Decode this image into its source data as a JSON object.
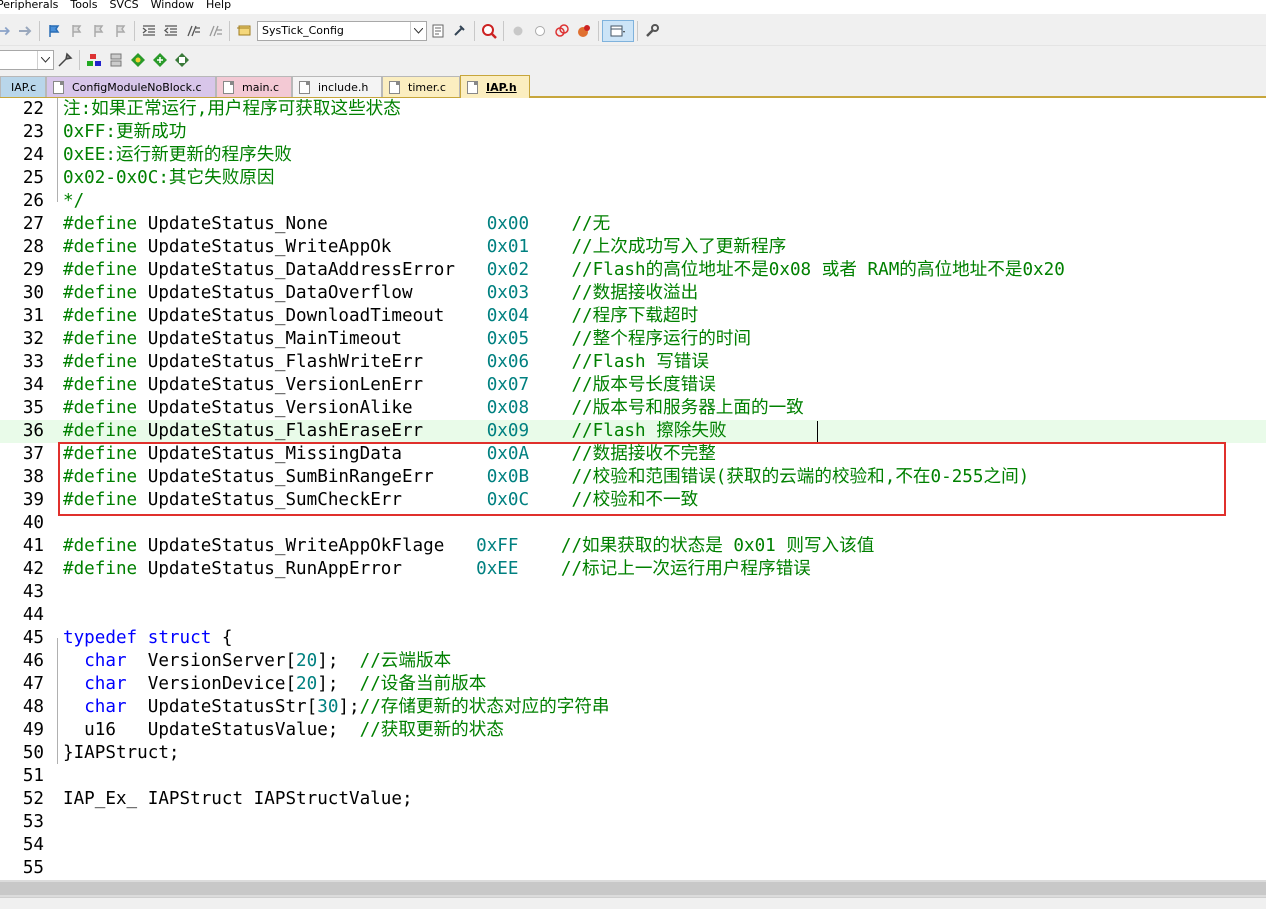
{
  "menu": [
    "Peripherals",
    "Tools",
    "SVCS",
    "Window",
    "Help"
  ],
  "toolbar": {
    "target_combo": "SysTick_Config"
  },
  "tabs": [
    {
      "label": "IAP.c",
      "color": "#b9d6ea"
    },
    {
      "label": "ConfigModuleNoBlock.c",
      "color": "#d8c6ea"
    },
    {
      "label": "main.c",
      "color": "#f3c9d4"
    },
    {
      "label": "include.h",
      "color": "#f4f4f4"
    },
    {
      "label": "timer.c",
      "color": "#fbeec0"
    },
    {
      "label": "IAP.h",
      "color": "#fbeec0"
    }
  ],
  "code": [
    {
      "n": "22",
      "t": [
        [
          "cm",
          "注:如果正常运行,用户程序可获取这些状态"
        ]
      ]
    },
    {
      "n": "23",
      "t": [
        [
          "cm",
          "0xFF:更新成功"
        ]
      ]
    },
    {
      "n": "24",
      "t": [
        [
          "cm",
          "0xEE:运行新更新的程序失败"
        ]
      ]
    },
    {
      "n": "25",
      "t": [
        [
          "cm",
          "0x02-0x0C:其它失败原因"
        ]
      ]
    },
    {
      "n": "26",
      "t": [
        [
          "cm",
          "*/"
        ]
      ]
    },
    {
      "n": "27",
      "t": [
        [
          "cm",
          "#define"
        ],
        [
          "tx",
          " UpdateStatus_None               "
        ],
        [
          "nm",
          "0x00"
        ],
        [
          "tx",
          "    "
        ],
        [
          "cm",
          "//无"
        ]
      ]
    },
    {
      "n": "28",
      "t": [
        [
          "cm",
          "#define"
        ],
        [
          "tx",
          " UpdateStatus_WriteAppOk         "
        ],
        [
          "nm",
          "0x01"
        ],
        [
          "tx",
          "    "
        ],
        [
          "cm",
          "//上次成功写入了更新程序"
        ]
      ]
    },
    {
      "n": "29",
      "t": [
        [
          "cm",
          "#define"
        ],
        [
          "tx",
          " UpdateStatus_DataAddressError   "
        ],
        [
          "nm",
          "0x02"
        ],
        [
          "tx",
          "    "
        ],
        [
          "cm",
          "//Flash的高位地址不是0x08 或者 RAM的高位地址不是0x20"
        ]
      ]
    },
    {
      "n": "30",
      "t": [
        [
          "cm",
          "#define"
        ],
        [
          "tx",
          " UpdateStatus_DataOverflow       "
        ],
        [
          "nm",
          "0x03"
        ],
        [
          "tx",
          "    "
        ],
        [
          "cm",
          "//数据接收溢出"
        ]
      ]
    },
    {
      "n": "31",
      "t": [
        [
          "cm",
          "#define"
        ],
        [
          "tx",
          " UpdateStatus_DownloadTimeout    "
        ],
        [
          "nm",
          "0x04"
        ],
        [
          "tx",
          "    "
        ],
        [
          "cm",
          "//程序下载超时"
        ]
      ]
    },
    {
      "n": "32",
      "t": [
        [
          "cm",
          "#define"
        ],
        [
          "tx",
          " UpdateStatus_MainTimeout        "
        ],
        [
          "nm",
          "0x05"
        ],
        [
          "tx",
          "    "
        ],
        [
          "cm",
          "//整个程序运行的时间"
        ]
      ]
    },
    {
      "n": "33",
      "t": [
        [
          "cm",
          "#define"
        ],
        [
          "tx",
          " UpdateStatus_FlashWriteErr      "
        ],
        [
          "nm",
          "0x06"
        ],
        [
          "tx",
          "    "
        ],
        [
          "cm",
          "//Flash 写错误"
        ]
      ]
    },
    {
      "n": "34",
      "t": [
        [
          "cm",
          "#define"
        ],
        [
          "tx",
          " UpdateStatus_VersionLenErr      "
        ],
        [
          "nm",
          "0x07"
        ],
        [
          "tx",
          "    "
        ],
        [
          "cm",
          "//版本号长度错误"
        ]
      ]
    },
    {
      "n": "35",
      "t": [
        [
          "cm",
          "#define"
        ],
        [
          "tx",
          " UpdateStatus_VersionAlike       "
        ],
        [
          "nm",
          "0x08"
        ],
        [
          "tx",
          "    "
        ],
        [
          "cm",
          "//版本号和服务器上面的一致"
        ]
      ]
    },
    {
      "n": "36",
      "t": [
        [
          "cm",
          "#define"
        ],
        [
          "tx",
          " UpdateStatus_FlashEraseErr      "
        ],
        [
          "nm",
          "0x09"
        ],
        [
          "tx",
          "    "
        ],
        [
          "cm",
          "//Flash 擦除失败"
        ]
      ]
    },
    {
      "n": "37",
      "t": [
        [
          "cm",
          "#define"
        ],
        [
          "tx",
          " UpdateStatus_MissingData        "
        ],
        [
          "nm",
          "0x0A"
        ],
        [
          "tx",
          "    "
        ],
        [
          "cm",
          "//数据接收不完整"
        ]
      ]
    },
    {
      "n": "38",
      "t": [
        [
          "cm",
          "#define"
        ],
        [
          "tx",
          " UpdateStatus_SumBinRangeErr     "
        ],
        [
          "nm",
          "0x0B"
        ],
        [
          "tx",
          "    "
        ],
        [
          "cm",
          "//校验和范围错误(获取的云端的校验和,不在0-255之间)"
        ]
      ]
    },
    {
      "n": "39",
      "t": [
        [
          "cm",
          "#define"
        ],
        [
          "tx",
          " UpdateStatus_SumCheckErr        "
        ],
        [
          "nm",
          "0x0C"
        ],
        [
          "tx",
          "    "
        ],
        [
          "cm",
          "//校验和不一致"
        ]
      ]
    },
    {
      "n": "40",
      "t": []
    },
    {
      "n": "41",
      "t": [
        [
          "cm",
          "#define"
        ],
        [
          "tx",
          " UpdateStatus_WriteAppOkFlage   "
        ],
        [
          "nm",
          "0xFF"
        ],
        [
          "tx",
          "    "
        ],
        [
          "cm",
          "//如果获取的状态是 0x01 则写入该值"
        ]
      ]
    },
    {
      "n": "42",
      "t": [
        [
          "cm",
          "#define"
        ],
        [
          "tx",
          " UpdateStatus_RunAppError       "
        ],
        [
          "nm",
          "0xEE"
        ],
        [
          "tx",
          "    "
        ],
        [
          "cm",
          "//标记上一次运行用户程序错误"
        ]
      ]
    },
    {
      "n": "43",
      "t": []
    },
    {
      "n": "44",
      "t": []
    },
    {
      "n": "45",
      "t": [
        [
          "kw",
          "typedef"
        ],
        [
          "tx",
          " "
        ],
        [
          "kw",
          "struct"
        ],
        [
          "tx",
          " {"
        ]
      ]
    },
    {
      "n": "46",
      "t": [
        [
          "tx",
          "  "
        ],
        [
          "kw",
          "char"
        ],
        [
          "tx",
          "  VersionServer["
        ],
        [
          "nm",
          "20"
        ],
        [
          "tx",
          "];  "
        ],
        [
          "cm",
          "//云端版本"
        ]
      ]
    },
    {
      "n": "47",
      "t": [
        [
          "tx",
          "  "
        ],
        [
          "kw",
          "char"
        ],
        [
          "tx",
          "  VersionDevice["
        ],
        [
          "nm",
          "20"
        ],
        [
          "tx",
          "];  "
        ],
        [
          "cm",
          "//设备当前版本"
        ]
      ]
    },
    {
      "n": "48",
      "t": [
        [
          "tx",
          "  "
        ],
        [
          "kw",
          "char"
        ],
        [
          "tx",
          "  UpdateStatusStr["
        ],
        [
          "nm",
          "30"
        ],
        [
          "tx",
          "];"
        ],
        [
          "cm",
          "//存储更新的状态对应的字符串"
        ]
      ]
    },
    {
      "n": "49",
      "t": [
        [
          "tx",
          "  u16   UpdateStatusValue;  "
        ],
        [
          "cm",
          "//获取更新的状态"
        ]
      ]
    },
    {
      "n": "50",
      "t": [
        [
          "tx",
          "}IAPStruct;"
        ]
      ]
    },
    {
      "n": "51",
      "t": []
    },
    {
      "n": "52",
      "t": [
        [
          "tx",
          "IAP_Ex_ IAPStruct IAPStructValue;"
        ]
      ]
    },
    {
      "n": "53",
      "t": []
    },
    {
      "n": "54",
      "t": []
    },
    {
      "n": "55",
      "t": []
    }
  ]
}
